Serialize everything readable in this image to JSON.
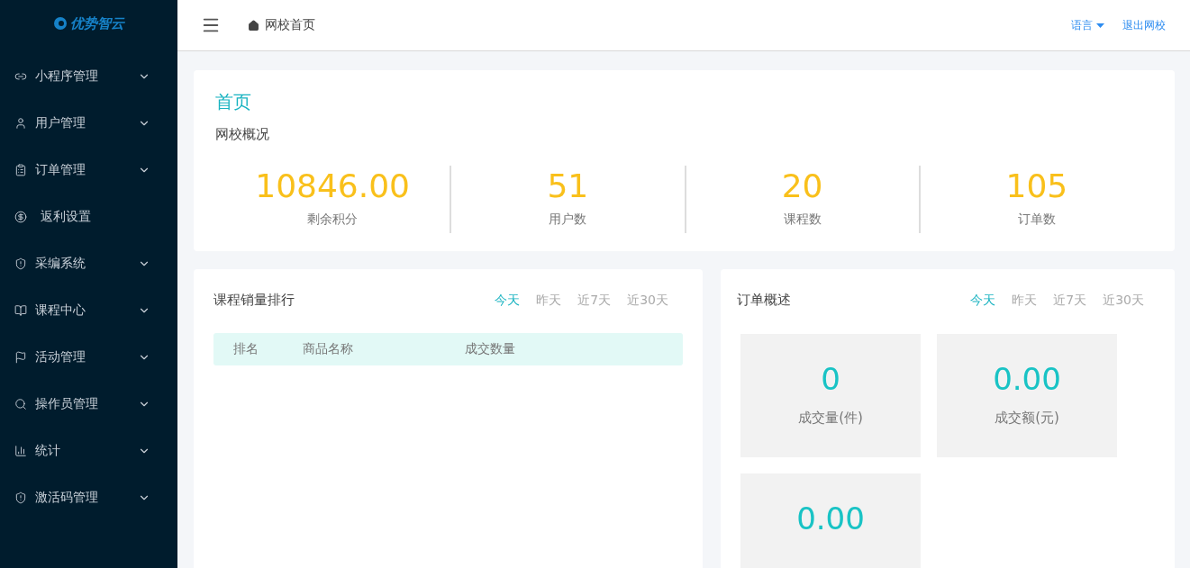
{
  "logo": {
    "text": "优势智云"
  },
  "sidebar": {
    "items": [
      {
        "kind": "menu",
        "label": "小程序管理",
        "expandable": true
      },
      {
        "kind": "menu",
        "label": "用户管理",
        "expandable": true
      },
      {
        "kind": "menu",
        "label": "订单管理",
        "expandable": true
      },
      {
        "kind": "menu",
        "label": "返利设置",
        "expandable": false
      },
      {
        "kind": "menu",
        "label": "采编系统",
        "expandable": true
      },
      {
        "kind": "menu",
        "label": "课程中心",
        "expandable": true
      },
      {
        "kind": "menu",
        "label": "活动管理",
        "expandable": true
      },
      {
        "kind": "menu",
        "label": "操作员管理",
        "expandable": true
      },
      {
        "kind": "menu",
        "label": "统计",
        "expandable": true
      },
      {
        "kind": "menu",
        "label": "激活码管理",
        "expandable": true
      }
    ]
  },
  "header": {
    "breadcrumb": "网校首页",
    "language": "语言",
    "logout": "退出网校"
  },
  "overview": {
    "title": "首页",
    "subtitle": "网校概况",
    "stats": [
      {
        "value": "10846.00",
        "label": "剩余积分"
      },
      {
        "value": "51",
        "label": "用户数"
      },
      {
        "value": "20",
        "label": "课程数"
      },
      {
        "value": "105",
        "label": "订单数"
      }
    ]
  },
  "sales_ranking": {
    "title": "课程销量排行",
    "filters": [
      {
        "label": "今天",
        "selected": true
      },
      {
        "label": "昨天",
        "selected": false
      },
      {
        "label": "近7天",
        "selected": false
      },
      {
        "label": "近30天",
        "selected": false
      }
    ],
    "columns": [
      "排名",
      "商品名称",
      "成交数量"
    ]
  },
  "order_overview": {
    "title": "订单概述",
    "filters": [
      {
        "label": "今天",
        "selected": true
      },
      {
        "label": "昨天",
        "selected": false
      },
      {
        "label": "近7天",
        "selected": false
      },
      {
        "label": "近30天",
        "selected": false
      }
    ],
    "tiles": [
      {
        "value": "0",
        "label": "成交量(件)"
      },
      {
        "value": "0.00",
        "label": "成交额(元)"
      },
      {
        "value": "0.00"
      }
    ]
  }
}
